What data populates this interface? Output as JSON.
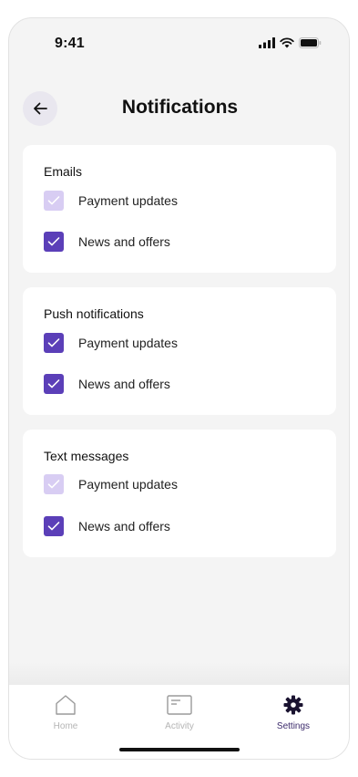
{
  "status_bar": {
    "time": "9:41"
  },
  "header": {
    "title": "Notifications",
    "back_icon": "arrow-left-icon"
  },
  "sections": [
    {
      "title": "Emails",
      "options": [
        {
          "label": "Payment updates",
          "checked": true,
          "disabled": true
        },
        {
          "label": "News and offers",
          "checked": true,
          "disabled": false
        }
      ]
    },
    {
      "title": "Push notifications",
      "options": [
        {
          "label": "Payment updates",
          "checked": true,
          "disabled": false
        },
        {
          "label": "News and offers",
          "checked": true,
          "disabled": false
        }
      ]
    },
    {
      "title": "Text messages",
      "options": [
        {
          "label": "Payment updates",
          "checked": true,
          "disabled": true
        },
        {
          "label": "News and offers",
          "checked": true,
          "disabled": false
        }
      ]
    }
  ],
  "tab_bar": {
    "tabs": [
      {
        "label": "Home",
        "icon": "home-icon",
        "active": false
      },
      {
        "label": "Activity",
        "icon": "activity-icon",
        "active": false
      },
      {
        "label": "Settings",
        "icon": "gear-icon",
        "active": true
      }
    ]
  },
  "colors": {
    "accent": "#5b3fb8",
    "accent_disabled": "#d8cdf3",
    "background": "#f4f4f4",
    "card": "#ffffff"
  }
}
